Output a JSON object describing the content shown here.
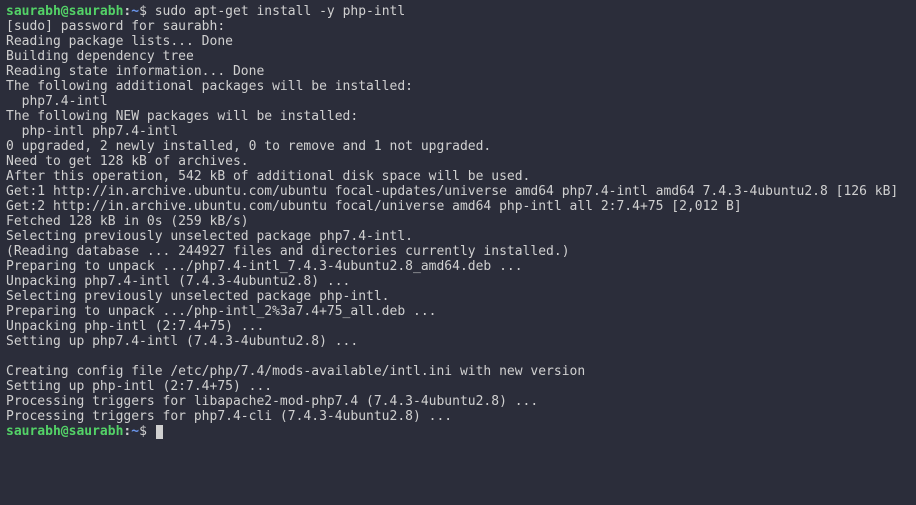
{
  "prompt1": {
    "user": "saurabh",
    "at": "@",
    "host": "saurabh",
    "colon": ":",
    "tilde": "~",
    "dollar": "$ ",
    "command": "sudo apt-get install -y php-intl"
  },
  "output": [
    "[sudo] password for saurabh:",
    "Reading package lists... Done",
    "Building dependency tree",
    "Reading state information... Done",
    "The following additional packages will be installed:",
    "  php7.4-intl",
    "The following NEW packages will be installed:",
    "  php-intl php7.4-intl",
    "0 upgraded, 2 newly installed, 0 to remove and 1 not upgraded.",
    "Need to get 128 kB of archives.",
    "After this operation, 542 kB of additional disk space will be used.",
    "Get:1 http://in.archive.ubuntu.com/ubuntu focal-updates/universe amd64 php7.4-intl amd64 7.4.3-4ubuntu2.8 [126 kB]",
    "Get:2 http://in.archive.ubuntu.com/ubuntu focal/universe amd64 php-intl all 2:7.4+75 [2,012 B]",
    "Fetched 128 kB in 0s (259 kB/s)",
    "Selecting previously unselected package php7.4-intl.",
    "(Reading database ... 244927 files and directories currently installed.)",
    "Preparing to unpack .../php7.4-intl_7.4.3-4ubuntu2.8_amd64.deb ...",
    "Unpacking php7.4-intl (7.4.3-4ubuntu2.8) ...",
    "Selecting previously unselected package php-intl.",
    "Preparing to unpack .../php-intl_2%3a7.4+75_all.deb ...",
    "Unpacking php-intl (2:7.4+75) ...",
    "Setting up php7.4-intl (7.4.3-4ubuntu2.8) ...",
    "",
    "Creating config file /etc/php/7.4/mods-available/intl.ini with new version",
    "Setting up php-intl (2:7.4+75) ...",
    "Processing triggers for libapache2-mod-php7.4 (7.4.3-4ubuntu2.8) ...",
    "Processing triggers for php7.4-cli (7.4.3-4ubuntu2.8) ..."
  ],
  "prompt2": {
    "user": "saurabh",
    "at": "@",
    "host": "saurabh",
    "colon": ":",
    "tilde": "~",
    "dollar": "$ "
  }
}
